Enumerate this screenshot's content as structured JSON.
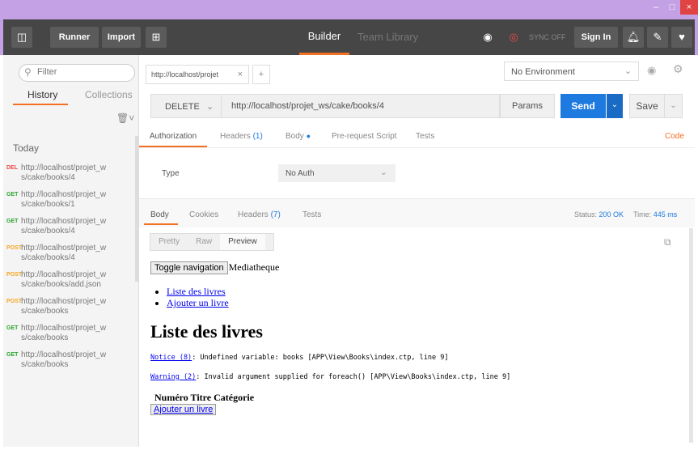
{
  "window": {
    "min": "–",
    "max": "□",
    "close": "×"
  },
  "toolbar": {
    "runner": "Runner",
    "import": "Import",
    "builder": "Builder",
    "team_library": "Team Library",
    "sync": "SYNC OFF",
    "sign_in": "Sign In"
  },
  "sidebar": {
    "filter_placeholder": "Filter",
    "tab_history": "History",
    "tab_collections": "Collections",
    "today": "Today",
    "items": [
      {
        "method": "DEL",
        "url": "http://localhost/projet_ws/cake/books/4"
      },
      {
        "method": "GET",
        "url": "http://localhost/projet_ws/cake/books/1"
      },
      {
        "method": "GET",
        "url": "http://localhost/projet_ws/cake/books/4"
      },
      {
        "method": "POST",
        "url": "http://localhost/projet_ws/cake/books/4"
      },
      {
        "method": "POST",
        "url": "http://localhost/projet_ws/cake/books/add.json"
      },
      {
        "method": "POST",
        "url": "http://localhost/projet_ws/cake/books"
      },
      {
        "method": "GET",
        "url": "http://localhost/projet_ws/cake/books"
      },
      {
        "method": "GET",
        "url": "http://localhost/projet_ws/cake/books"
      }
    ]
  },
  "request": {
    "tab_label": "http://localhost/projet",
    "environment": "No Environment",
    "method": "DELETE",
    "url": "http://localhost/projet_ws/cake/books/4",
    "params": "Params",
    "send": "Send",
    "save": "Save",
    "tabs": {
      "authorization": "Authorization",
      "headers": "Headers",
      "headers_count": "(1)",
      "body": "Body",
      "prerequest": "Pre-request Script",
      "tests": "Tests",
      "code": "Code"
    },
    "auth_type_label": "Type",
    "auth_type_value": "No Auth"
  },
  "response": {
    "tabs": {
      "body": "Body",
      "cookies": "Cookies",
      "headers": "Headers",
      "headers_count": "(7)",
      "tests": "Tests"
    },
    "status_label": "Status:",
    "status_value": "200 OK",
    "time_label": "Time:",
    "time_value": "445 ms",
    "view_modes": [
      "Pretty",
      "Raw",
      "Preview"
    ],
    "preview": {
      "toggle_nav": "Toggle navigation",
      "brand": "Mediatheque",
      "nav_links": [
        "Liste des livres",
        "Ajouter un livre"
      ],
      "heading": "Liste des livres",
      "notice_label": "Notice (8)",
      "notice_text": ": Undefined variable: books [APP\\View\\Books\\index.ctp, line 9]",
      "warning_label": "Warning (2)",
      "warning_text": ": Invalid argument supplied for foreach() [APP\\View\\Books\\index.ctp, line 9]",
      "table_headers": "Numéro Titre Catégorie",
      "add_button": "Ajouter un livre"
    }
  }
}
